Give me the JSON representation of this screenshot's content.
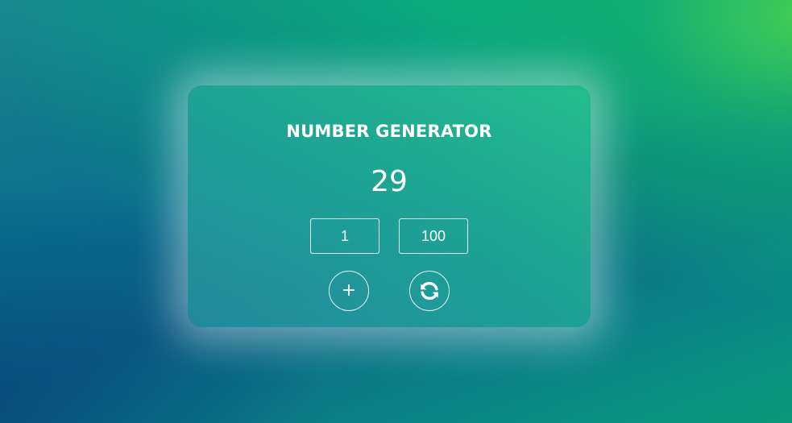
{
  "app": {
    "title": "NUMBER GENERATOR",
    "result": "29"
  },
  "range": {
    "min": "1",
    "max": "100"
  },
  "buttons": {
    "add_label": "+",
    "refresh_icon": "refresh-icon"
  },
  "colors": {
    "text": "#ffffff",
    "card_tint": "#20a898",
    "background_green": "#46d250",
    "background_blue": "#0a5f86"
  }
}
